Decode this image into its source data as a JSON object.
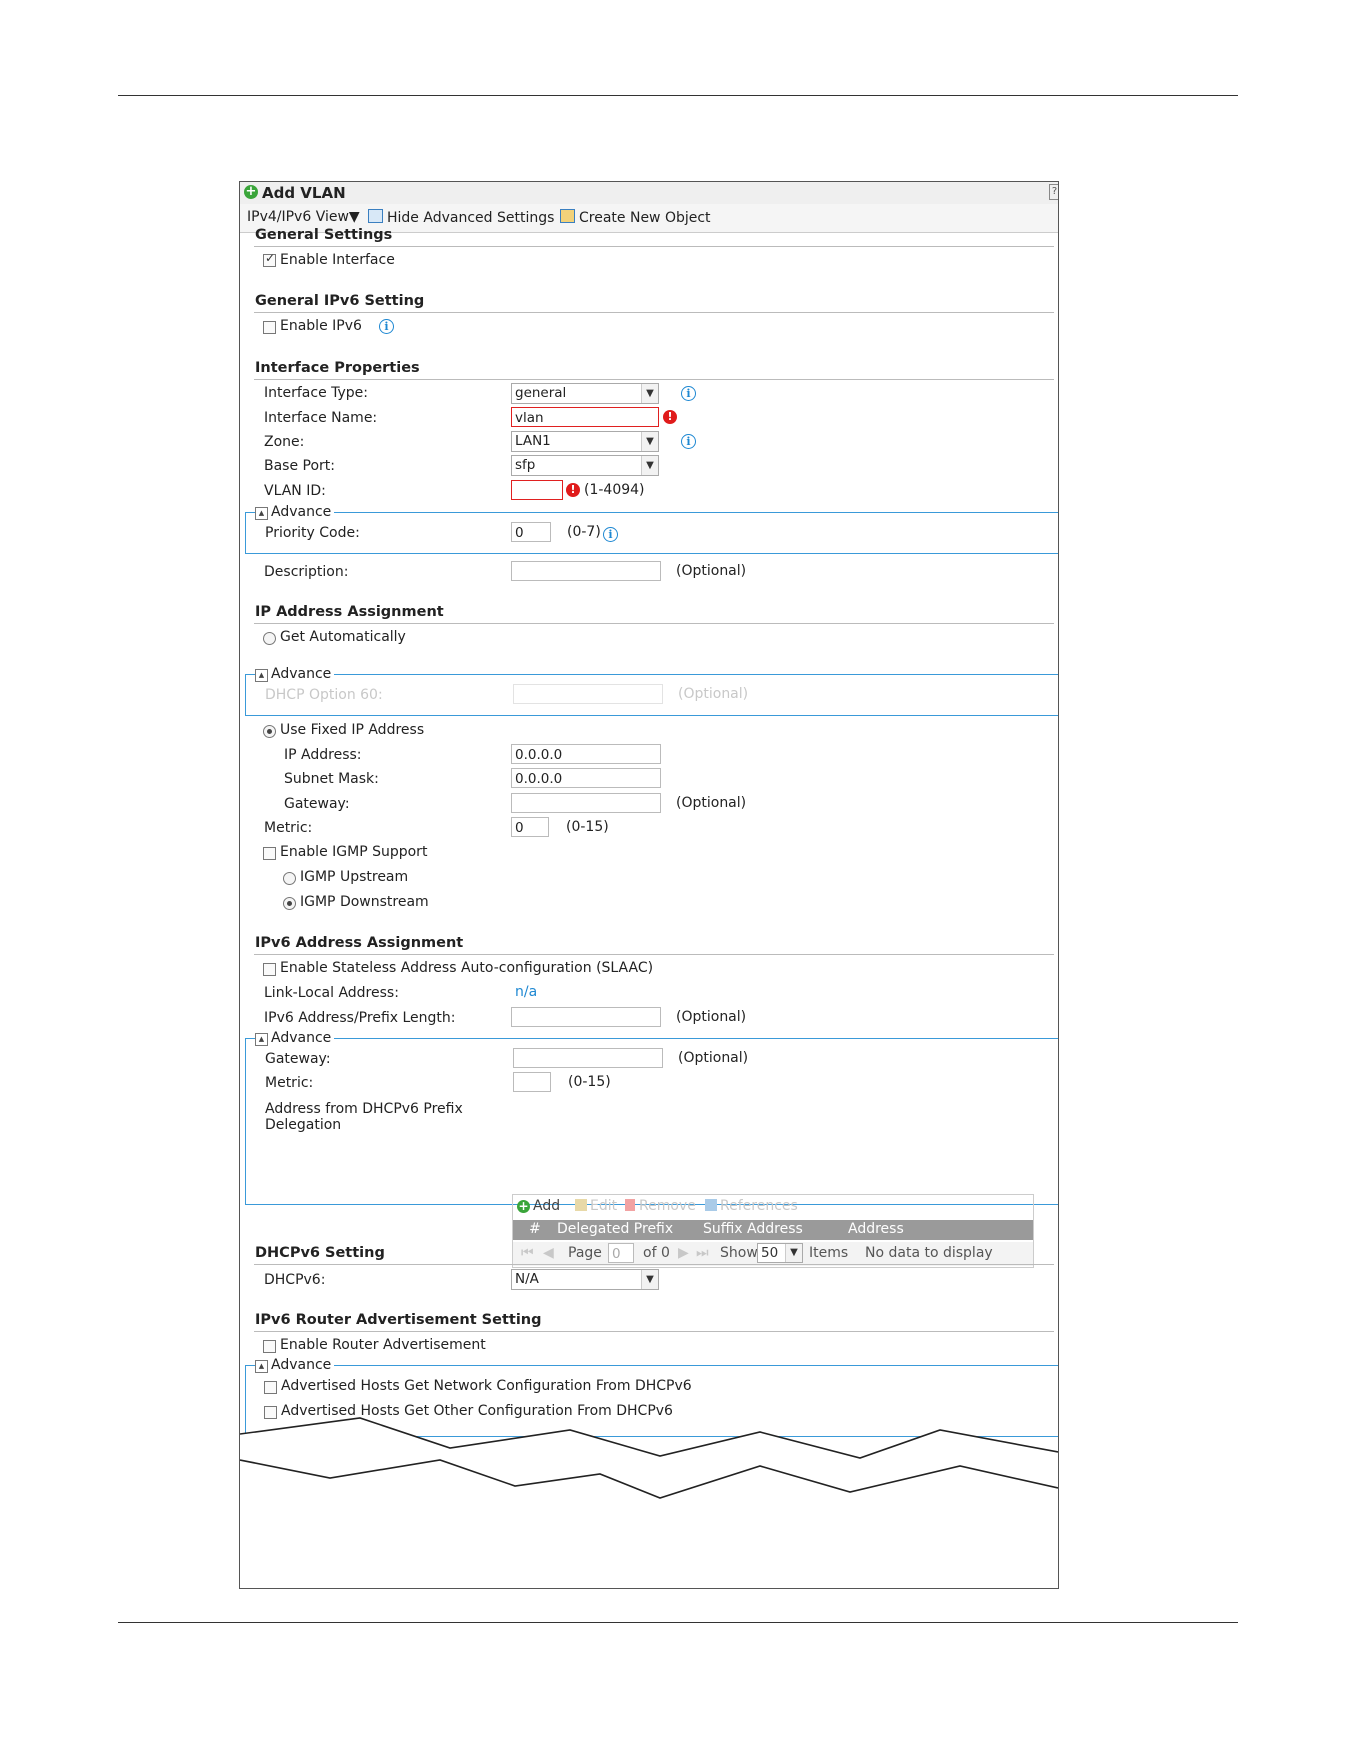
{
  "dialog": {
    "title": "Add VLAN",
    "help_icon": "?"
  },
  "toolbar": {
    "view_label": "IPv4/IPv6 View▼",
    "hide_advanced_label": "Hide Advanced Settings",
    "create_object_label": "Create New Object"
  },
  "general": {
    "heading": "General Settings",
    "enable_interface_label": "Enable Interface",
    "enable_interface_checked": true
  },
  "general_ipv6": {
    "heading": "General IPv6 Setting",
    "enable_ipv6_label": "Enable IPv6",
    "enable_ipv6_checked": false
  },
  "iface": {
    "heading": "Interface Properties",
    "type_label": "Interface Type:",
    "type_value": "general",
    "name_label": "Interface Name:",
    "name_value": "vlan",
    "zone_label": "Zone:",
    "zone_value": "LAN1",
    "base_port_label": "Base Port:",
    "base_port_value": "sfp",
    "vlan_id_label": "VLAN ID:",
    "vlan_id_value": "",
    "vlan_id_range": "(1-4094)",
    "advance_label": "Advance",
    "priority_label": "Priority Code:",
    "priority_value": "0",
    "priority_range": "(0-7)",
    "description_label": "Description:",
    "description_value": "",
    "optional": "(Optional)"
  },
  "ip": {
    "heading": "IP Address Assignment",
    "get_auto_label": "Get Automatically",
    "advance_label": "Advance",
    "dhcp60_label": "DHCP Option 60:",
    "dhcp60_optional": "(Optional)",
    "use_fixed_label": "Use Fixed IP Address",
    "ip_label": "IP Address:",
    "ip_value": "0.0.0.0",
    "mask_label": "Subnet Mask:",
    "mask_value": "0.0.0.0",
    "gateway_label": "Gateway:",
    "gateway_value": "",
    "gateway_optional": "(Optional)",
    "metric_label": "Metric:",
    "metric_value": "0",
    "metric_range": "(0-15)",
    "igmp_label": "Enable IGMP Support",
    "igmp_up_label": "IGMP Upstream",
    "igmp_down_label": "IGMP Downstream"
  },
  "ipv6": {
    "heading": "IPv6 Address Assignment",
    "slaac_label": "Enable Stateless Address Auto-configuration (SLAAC)",
    "link_local_label": "Link-Local Address:",
    "link_local_value": "n/a",
    "prefix_label": "IPv6 Address/Prefix Length:",
    "prefix_optional": "(Optional)",
    "advance_label": "Advance",
    "gateway_label": "Gateway:",
    "gateway_optional": "(Optional)",
    "metric_label": "Metric:",
    "metric_range": "(0-15)",
    "pd_label_line1": "Address from DHCPv6 Prefix",
    "pd_label_line2": "Delegation",
    "grid": {
      "add": "Add",
      "edit": "Edit",
      "remove": "Remove",
      "references": "References",
      "columns": [
        "#",
        "Delegated Prefix",
        "Suffix Address",
        "Address"
      ],
      "page_label": "Page",
      "page_value": "0",
      "of_label": "of 0",
      "show_label": "Show",
      "show_value": "50",
      "items_label": "Items",
      "empty_label": "No data to display"
    }
  },
  "dhcpv6": {
    "heading": "DHCPv6 Setting",
    "label": "DHCPv6:",
    "value": "N/A"
  },
  "ra": {
    "heading": "IPv6 Router Advertisement Setting",
    "enable_label": "Enable Router Advertisement",
    "advance_label": "Advance",
    "managed_label": "Advertised Hosts Get Network Configuration From DHCPv6",
    "other_label": "Advertised Hosts Get Other Configuration From DHCPv6"
  },
  "colors": {
    "accent_blue": "#1e88d2",
    "error_red": "#e01b1b",
    "advance_border": "#3a9ad9",
    "grid_header": "#9a9a9a"
  }
}
